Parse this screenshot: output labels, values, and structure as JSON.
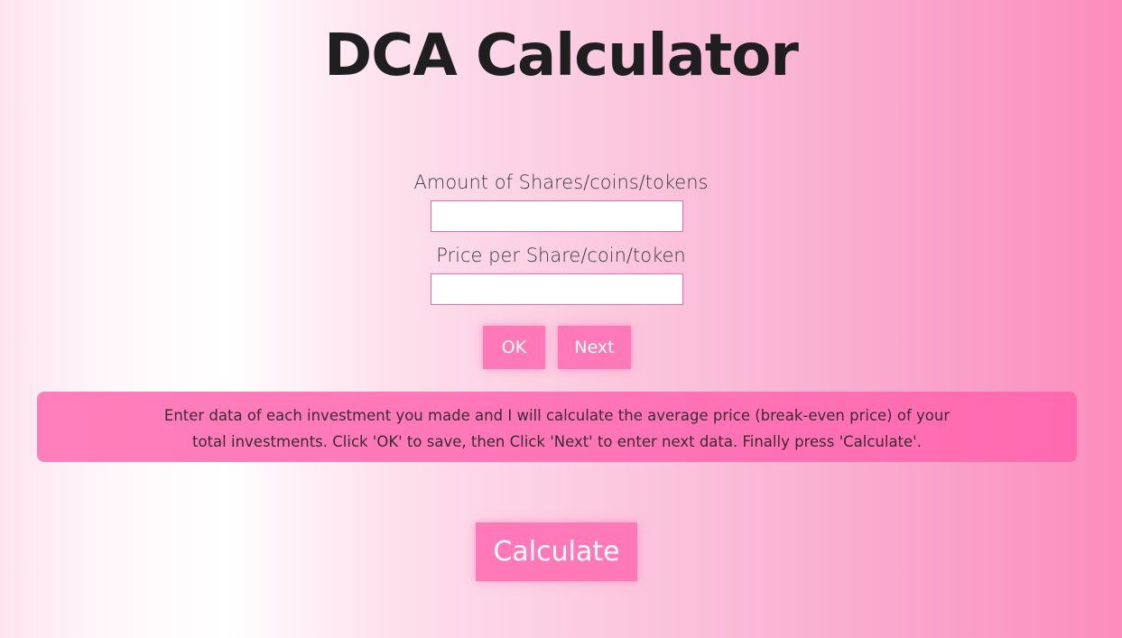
{
  "header": {
    "title": "DCA Calculator"
  },
  "form": {
    "amount_label": "Amount of Shares/coins/tokens",
    "amount_value": "",
    "price_label": "Price per Share/coin/token",
    "price_value": ""
  },
  "buttons": {
    "ok_label": "OK",
    "next_label": "Next",
    "calculate_label": "Calculate"
  },
  "info": {
    "text": "Enter data of each investment you made and I will calculate the average price (break-even price) of your total investments. Click 'OK' to save, then Click 'Next' to enter next data. Finally press 'Calculate'."
  },
  "colors": {
    "accent": "#ff79b9",
    "input_border": "#e66bb0",
    "title": "#1f1f1f"
  }
}
